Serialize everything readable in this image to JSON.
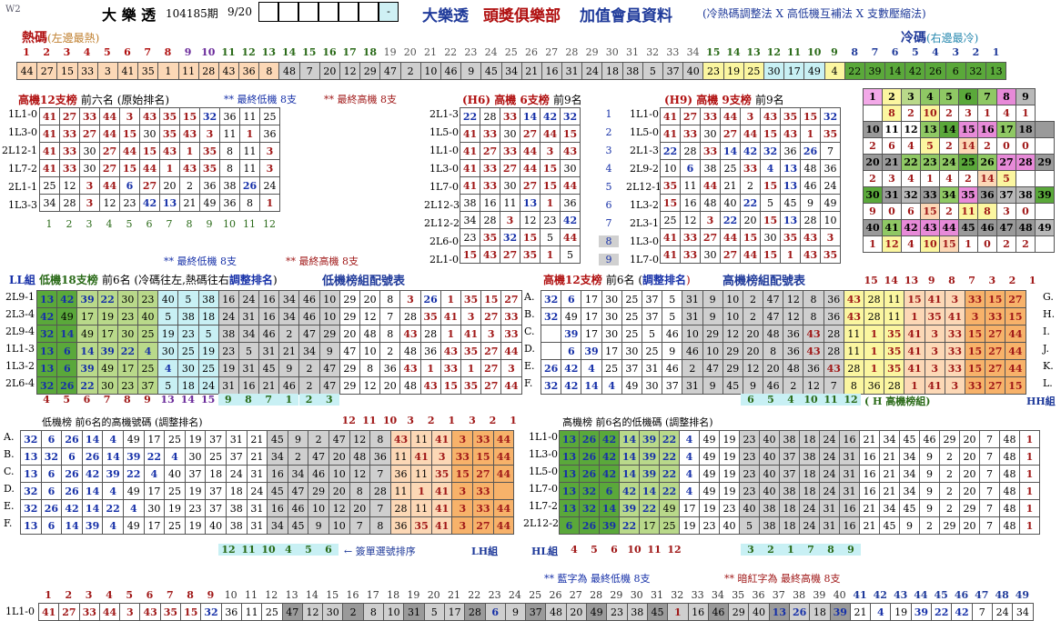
{
  "header": {
    "code": "W2",
    "title": "大 樂 透",
    "period": "104185期",
    "date": "9/20",
    "dash": "-",
    "main_title_1": "大樂透",
    "main_title_2": "頭獎俱樂部",
    "main_title_3": "加值會員資料",
    "subtitle": "(冷熱碼調整法 X 高低機互補法 X 支數壓縮法)"
  },
  "hot_cold": {
    "hot": "熱碼",
    "hot_note": "(左邊最熱)",
    "cold": "冷碼",
    "cold_note": "(右邊最冷)",
    "index": [
      "1",
      "2",
      "3",
      "4",
      "5",
      "6",
      "7",
      "8",
      "9",
      "10",
      "11",
      "12",
      "13",
      "14",
      "15",
      "16",
      "17",
      "18",
      "19",
      "20",
      "21",
      "22",
      "23",
      "24",
      "25",
      "26",
      "27",
      "28",
      "29",
      "30",
      "31",
      "32",
      "33",
      "34",
      "35",
      "36",
      "37",
      "38",
      "39",
      "40",
      "41",
      "42",
      "43",
      "44",
      "45",
      "46",
      "47",
      "48",
      "49"
    ],
    "index_r": [
      "15",
      "14",
      "13",
      "12",
      "11",
      "10",
      "9",
      "8",
      "7",
      "6",
      "5",
      "4",
      "3",
      "2",
      "1"
    ],
    "values": [
      "44",
      "27",
      "15",
      "33",
      "3",
      "41",
      "35",
      "1",
      "11",
      "28",
      "43",
      "36",
      "8",
      "48",
      "7",
      "20",
      "12",
      "29",
      "47",
      "2",
      "10",
      "46",
      "9",
      "45",
      "34",
      "21",
      "16",
      "31",
      "24",
      "18",
      "38",
      "5",
      "37",
      "40",
      "23",
      "19",
      "25",
      "30",
      "17",
      "49",
      "4",
      "22",
      "39",
      "14",
      "42",
      "26",
      "6",
      "32",
      "13"
    ]
  },
  "hi12": {
    "title": "高機12支榜",
    "note": "前六名 (原始排名)",
    "low_note": "** 最終低機 8支",
    "high_note": "** 最終高機 8支",
    "rows": [
      [
        "1L1-0",
        "41",
        "27",
        "33",
        "44",
        "3",
        "43",
        "35",
        "15",
        "32",
        "36",
        "11",
        "25"
      ],
      [
        "1L3-0",
        "41",
        "33",
        "27",
        "44",
        "15",
        "30",
        "35",
        "43",
        "3",
        "11",
        "1",
        "36"
      ],
      [
        "2L12-1",
        "41",
        "33",
        "30",
        "27",
        "44",
        "15",
        "43",
        "1",
        "35",
        "8",
        "11",
        "3"
      ],
      [
        "1L7-2",
        "41",
        "33",
        "30",
        "27",
        "15",
        "44",
        "1",
        "43",
        "35",
        "8",
        "11",
        "3"
      ],
      [
        "2L1-1",
        "25",
        "12",
        "3",
        "44",
        "6",
        "27",
        "20",
        "2",
        "36",
        "38",
        "26",
        "24"
      ],
      [
        "1L3-3",
        "34",
        "28",
        "3",
        "12",
        "23",
        "42",
        "13",
        "21",
        "49",
        "36",
        "8",
        "1"
      ]
    ],
    "foot": [
      "1",
      "2",
      "3",
      "4",
      "5",
      "6",
      "7",
      "8",
      "9",
      "10",
      "11",
      "12"
    ]
  },
  "h6": {
    "title": "(H6) 高機 6支榜",
    "note": "前9名",
    "idx": [
      "1",
      "2",
      "3",
      "4",
      "5",
      "6",
      "7",
      "8",
      "9"
    ],
    "rows": [
      [
        "2L1-3",
        "22",
        "28",
        "33",
        "14",
        "42",
        "32"
      ],
      [
        "1L5-0",
        "41",
        "33",
        "30",
        "27",
        "44",
        "15"
      ],
      [
        "1L1-0",
        "41",
        "27",
        "33",
        "44",
        "3",
        "43"
      ],
      [
        "1L3-0",
        "41",
        "33",
        "27",
        "44",
        "15",
        "30"
      ],
      [
        "1L7-0",
        "41",
        "33",
        "30",
        "27",
        "15",
        "44"
      ],
      [
        "2L12-3",
        "38",
        "16",
        "11",
        "13",
        "1",
        "36"
      ],
      [
        "2L12-2",
        "34",
        "28",
        "3",
        "12",
        "23",
        "42"
      ],
      [
        "2L6-0",
        "23",
        "35",
        "32",
        "15",
        "5",
        "44"
      ],
      [
        "2L1-0",
        "15",
        "43",
        "27",
        "35",
        "1",
        "5"
      ]
    ]
  },
  "h9": {
    "title": "(H9) 高機 9支榜",
    "note": "前9名",
    "rows": [
      [
        "1L1-0",
        "41",
        "27",
        "33",
        "44",
        "3",
        "43",
        "35",
        "15",
        "32"
      ],
      [
        "1L5-0",
        "41",
        "33",
        "30",
        "27",
        "44",
        "15",
        "43",
        "1",
        "35"
      ],
      [
        "2L1-3",
        "22",
        "28",
        "33",
        "14",
        "42",
        "32",
        "36",
        "26",
        "7"
      ],
      [
        "2L9-2",
        "10",
        "6",
        "38",
        "25",
        "33",
        "4",
        "13",
        "48",
        "36"
      ],
      [
        "2L12-1",
        "35",
        "11",
        "44",
        "21",
        "2",
        "15",
        "13",
        "46",
        "24"
      ],
      [
        "1L3-2",
        "15",
        "16",
        "48",
        "40",
        "22",
        "5",
        "45",
        "9",
        "49"
      ],
      [
        "2L3-1",
        "25",
        "12",
        "3",
        "22",
        "20",
        "15",
        "13",
        "28",
        "10"
      ],
      [
        "1L3-0",
        "41",
        "33",
        "27",
        "44",
        "15",
        "30",
        "35",
        "43",
        "3"
      ],
      [
        "1L7-0",
        "41",
        "33",
        "30",
        "27",
        "44",
        "15",
        "1",
        "43",
        "35"
      ]
    ]
  },
  "grid9": {
    "rows": [
      [
        "1",
        "2",
        "3",
        "4",
        "5",
        "6",
        "7",
        "8",
        "9"
      ],
      [
        "",
        "8",
        "2",
        "10",
        "2",
        "3",
        "1",
        "4",
        "1"
      ],
      [
        "10",
        "11",
        "12",
        "13",
        "14",
        "15",
        "16",
        "17",
        "18"
      ],
      [
        "2",
        "6",
        "4",
        "5",
        "2",
        "14",
        "2",
        "0",
        "0"
      ],
      [
        "20",
        "21",
        "22",
        "23",
        "24",
        "25",
        "26",
        "27",
        "28",
        "29"
      ],
      [
        "2",
        "3",
        "4",
        "1",
        "4",
        "2",
        "14",
        "5",
        ""
      ],
      [
        "30",
        "31",
        "32",
        "33",
        "34",
        "35",
        "36",
        "37",
        "38",
        "39"
      ],
      [
        "9",
        "0",
        "6",
        "15",
        "2",
        "11",
        "8",
        "3",
        "0"
      ],
      [
        "40",
        "41",
        "42",
        "43",
        "44",
        "45",
        "46",
        "47",
        "48",
        "49"
      ],
      [
        "1",
        "12",
        "4",
        "10",
        "15",
        "1",
        "0",
        "2",
        "2"
      ]
    ]
  },
  "notes": {
    "low": "** 最終低機 8支",
    "high": "** 最終高機 8支"
  },
  "ll": {
    "title": "LL組",
    "title2": "低機18支榜",
    "note": "前6名 (冷碼往左,熱碼往右",
    "adj": "調整排名",
    "close": ")",
    "table_title": "低機榜組配號表",
    "labels": [
      "2L9-1",
      "2L3-4",
      "2L9-4",
      "1L1-3",
      "1L3-2",
      "2L6-4"
    ],
    "rows": [
      [
        "13",
        "42",
        "39",
        "22",
        "30",
        "23",
        "40",
        "5",
        "38",
        "16",
        "24",
        "16",
        "34",
        "46",
        "10",
        "29",
        "20",
        "8",
        "3",
        "26",
        "1",
        "35",
        "15",
        "27"
      ],
      [
        "42",
        "49",
        "17",
        "19",
        "23",
        "40",
        "5",
        "38",
        "18",
        "24",
        "31",
        "16",
        "34",
        "46",
        "10",
        "29",
        "12",
        "7",
        "28",
        "35",
        "41",
        "3",
        "27",
        "33"
      ],
      [
        "32",
        "14",
        "49",
        "17",
        "30",
        "25",
        "19",
        "23",
        "5",
        "38",
        "34",
        "46",
        "2",
        "47",
        "29",
        "20",
        "48",
        "8",
        "43",
        "28",
        "1",
        "41",
        "3",
        "33"
      ],
      [
        "13",
        "6",
        "14",
        "39",
        "22",
        "4",
        "30",
        "25",
        "19",
        "23",
        "5",
        "31",
        "21",
        "34",
        "9",
        "47",
        "10",
        "2",
        "48",
        "36",
        "43",
        "35",
        "27",
        "44"
      ],
      [
        "13",
        "6",
        "39",
        "49",
        "17",
        "25",
        "4",
        "30",
        "25",
        "19",
        "31",
        "45",
        "9",
        "2",
        "47",
        "29",
        "8",
        "36",
        "43",
        "1",
        "33",
        "1",
        "27",
        "3"
      ],
      [
        "32",
        "26",
        "22",
        "30",
        "23",
        "37",
        "5",
        "18",
        "24",
        "31",
        "16",
        "21",
        "46",
        "2",
        "47",
        "29",
        "12",
        "20",
        "48",
        "43",
        "15",
        "35",
        "27",
        "44"
      ]
    ],
    "foot1": [
      "4",
      "5",
      "6",
      "7",
      "8",
      "9",
      "13",
      "14",
      "15"
    ],
    "foot2": [
      "9",
      "8",
      "7",
      "1",
      "2",
      "3"
    ]
  },
  "abc": [
    "A.",
    "B.",
    "C.",
    "D.",
    "E.",
    "F."
  ],
  "hl": {
    "title": "高機12支榜",
    "note": "前6名 (",
    "adj": "調整排名",
    "close": ")",
    "table_title": "高機榜組配號表",
    "top": [
      "15",
      "14",
      "13",
      "9",
      "8",
      "7",
      "3",
      "2",
      "1"
    ],
    "letters": [
      "G.",
      "H.",
      "I.",
      "J.",
      "K.",
      "L."
    ],
    "rows": [
      [
        "32",
        "6",
        "17",
        "30",
        "25",
        "37",
        "5",
        "31",
        "9",
        "10",
        "2",
        "47",
        "12",
        "8",
        "36",
        "43",
        "28",
        "11",
        "15",
        "41",
        "3",
        "33",
        "15",
        "27",
        "44"
      ],
      [
        "32",
        "49",
        "17",
        "30",
        "25",
        "37",
        "5",
        "31",
        "9",
        "10",
        "2",
        "47",
        "12",
        "8",
        "36",
        "43",
        "28",
        "11",
        "1",
        "35",
        "41",
        "3",
        "33",
        "15",
        "27",
        "44"
      ],
      [
        "39",
        "17",
        "30",
        "25",
        "5",
        "46",
        "10",
        "29",
        "12",
        "20",
        "48",
        "36",
        "43",
        "28",
        "11",
        "1",
        "35",
        "41",
        "3",
        "33",
        "15",
        "27",
        "44"
      ],
      [
        "6",
        "39",
        "17",
        "30",
        "25",
        "9",
        "46",
        "10",
        "29",
        "20",
        "8",
        "36",
        "43",
        "28",
        "11",
        "1",
        "35",
        "41",
        "3",
        "33",
        "15",
        "27",
        "44"
      ],
      [
        "26",
        "42",
        "4",
        "25",
        "37",
        "31",
        "46",
        "2",
        "47",
        "29",
        "12",
        "20",
        "48",
        "36",
        "43",
        "28",
        "1",
        "35",
        "41",
        "3",
        "33",
        "15",
        "27",
        "44"
      ],
      [
        "32",
        "42",
        "14",
        "4",
        "49",
        "30",
        "37",
        "31",
        "9",
        "45",
        "9",
        "46",
        "2",
        "12",
        "7",
        "8",
        "36",
        "28",
        "1",
        "41",
        "3",
        "33",
        "27",
        "15"
      ]
    ],
    "foot": [
      "6",
      "5",
      "4",
      "10",
      "11",
      "12"
    ],
    "foot_note": "( H 高機榜組)",
    "foot_tag": "HH組"
  },
  "lh": {
    "title": "低機榜 前6名的高機號碼 (調整排名)",
    "top": [
      "12",
      "11",
      "10",
      "3",
      "2",
      "1",
      "3",
      "2",
      "1"
    ],
    "rows": [
      [
        "32",
        "6",
        "26",
        "14",
        "4",
        "49",
        "17",
        "25",
        "19",
        "37",
        "31",
        "21",
        "45",
        "9",
        "2",
        "47",
        "12",
        "8",
        "43",
        "11",
        "41",
        "3",
        "33",
        "44"
      ],
      [
        "13",
        "32",
        "6",
        "26",
        "14",
        "39",
        "22",
        "4",
        "30",
        "25",
        "37",
        "21",
        "34",
        "2",
        "47",
        "20",
        "48",
        "36",
        "11",
        "41",
        "3",
        "33",
        "15",
        "44"
      ],
      [
        "13",
        "6",
        "26",
        "42",
        "39",
        "22",
        "4",
        "40",
        "37",
        "18",
        "24",
        "31",
        "16",
        "34",
        "46",
        "10",
        "12",
        "7",
        "36",
        "11",
        "35",
        "15",
        "27",
        "44"
      ],
      [
        "32",
        "6",
        "26",
        "14",
        "4",
        "49",
        "17",
        "25",
        "19",
        "37",
        "18",
        "24",
        "45",
        "47",
        "29",
        "20",
        "8",
        "28",
        "11",
        "1",
        "41",
        "3",
        "33"
      ],
      [
        "32",
        "26",
        "42",
        "14",
        "22",
        "4",
        "30",
        "19",
        "23",
        "37",
        "38",
        "31",
        "16",
        "46",
        "10",
        "12",
        "20",
        "7",
        "28",
        "11",
        "41",
        "3",
        "33",
        "44"
      ],
      [
        "13",
        "6",
        "14",
        "39",
        "4",
        "49",
        "17",
        "25",
        "19",
        "40",
        "38",
        "31",
        "34",
        "45",
        "9",
        "10",
        "7",
        "8",
        "36",
        "35",
        "41",
        "3",
        "27",
        "44"
      ]
    ],
    "foot": [
      "12",
      "11",
      "10",
      "4",
      "5",
      "6"
    ],
    "arrow": "← 簽單選號排序",
    "tag": "LH組"
  },
  "hll": {
    "title": "高機榜 前6名的低機碼 (調整排名)",
    "labels": [
      "1L1-0",
      "1L3-0",
      "1L5-0",
      "1L7-0",
      "1L7-2",
      "2L12-2"
    ],
    "rows": [
      [
        "13",
        "26",
        "42",
        "14",
        "39",
        "22",
        "4",
        "49",
        "19",
        "23",
        "40",
        "38",
        "18",
        "24",
        "16",
        "21",
        "34",
        "45",
        "46",
        "29",
        "20",
        "7",
        "48",
        "1"
      ],
      [
        "13",
        "26",
        "42",
        "14",
        "39",
        "22",
        "4",
        "49",
        "19",
        "23",
        "40",
        "37",
        "38",
        "24",
        "31",
        "16",
        "21",
        "34",
        "9",
        "2",
        "20",
        "7",
        "48",
        "1"
      ],
      [
        "13",
        "26",
        "42",
        "14",
        "39",
        "22",
        "4",
        "49",
        "19",
        "23",
        "40",
        "37",
        "18",
        "24",
        "31",
        "16",
        "21",
        "34",
        "9",
        "2",
        "20",
        "7",
        "48",
        "1"
      ],
      [
        "13",
        "32",
        "6",
        "42",
        "14",
        "22",
        "4",
        "49",
        "19",
        "23",
        "40",
        "38",
        "18",
        "24",
        "31",
        "16",
        "21",
        "34",
        "9",
        "2",
        "20",
        "7",
        "48",
        "1"
      ],
      [
        "13",
        "32",
        "14",
        "39",
        "22",
        "49",
        "17",
        "19",
        "23",
        "40",
        "38",
        "18",
        "24",
        "31",
        "16",
        "21",
        "34",
        "45",
        "9",
        "2",
        "29",
        "7",
        "48",
        "1"
      ],
      [
        "6",
        "26",
        "39",
        "22",
        "17",
        "25",
        "19",
        "23",
        "40",
        "5",
        "38",
        "18",
        "24",
        "31",
        "16",
        "21",
        "45",
        "9",
        "2",
        "29",
        "20",
        "7",
        "48",
        "1"
      ]
    ],
    "last": [
      "E.",
      "F."
    ],
    "extra": [
      [
        "35",
        "41"
      ],
      [
        "35",
        "44"
      ]
    ],
    "foot_l": "HL組",
    "foot": [
      "4",
      "5",
      "6",
      "10",
      "11",
      "12"
    ],
    "foot2": [
      "3",
      "2",
      "1",
      "7",
      "8",
      "9"
    ]
  },
  "legend": {
    "blue": "** 藍字為 最終低機 8支",
    "red": "** 暗紅字為 最終高機 8支"
  },
  "bottom": {
    "label": "1L1-0",
    "index": [
      "1",
      "2",
      "3",
      "4",
      "5",
      "6",
      "7",
      "8",
      "9",
      "10",
      "11",
      "12",
      "13",
      "14",
      "15",
      "16",
      "17",
      "18",
      "19",
      "20",
      "21",
      "22",
      "23",
      "24",
      "25",
      "26",
      "27",
      "28",
      "29",
      "30",
      "31",
      "32",
      "33",
      "34",
      "35",
      "36",
      "37",
      "38",
      "39",
      "40",
      "41",
      "42",
      "43",
      "44",
      "45",
      "46",
      "47",
      "48",
      "49"
    ],
    "values": [
      "41",
      "27",
      "33",
      "44",
      "3",
      "43",
      "35",
      "15",
      "32",
      "36",
      "11",
      "25",
      "47",
      "12",
      "30",
      "2",
      "8",
      "10",
      "31",
      "5",
      "17",
      "28",
      "6",
      "9",
      "37",
      "48",
      "20",
      "49",
      "23",
      "38",
      "45",
      "1",
      "16",
      "46",
      "29",
      "40",
      "13",
      "26",
      "18",
      "39",
      "21",
      "4",
      "19",
      "39",
      "22",
      "42",
      "7",
      "24",
      "34"
    ]
  }
}
